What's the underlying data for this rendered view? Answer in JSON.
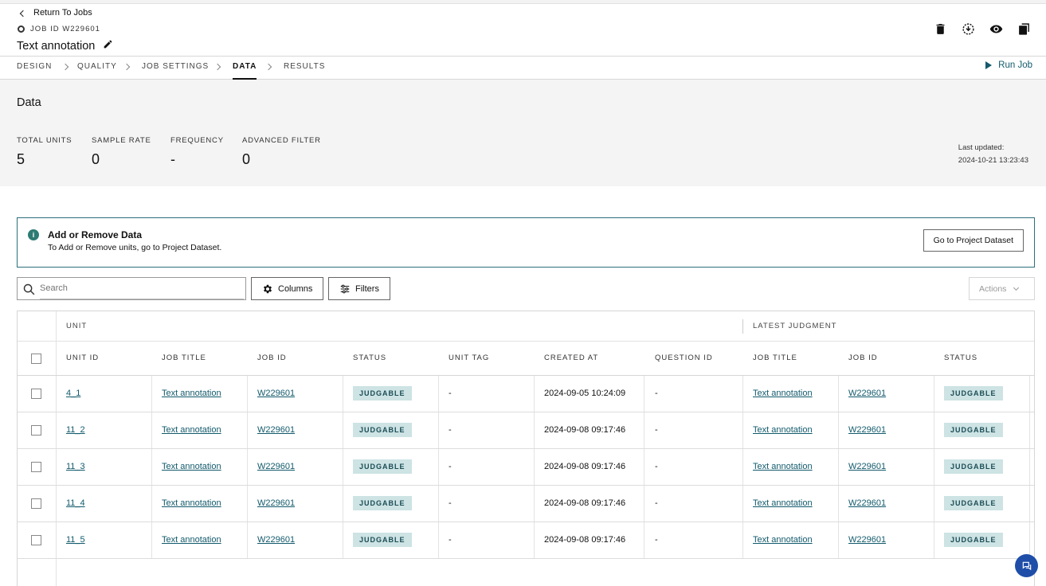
{
  "header": {
    "back_label": "Return To Jobs",
    "job_id_label": "JOB ID W229601",
    "title": "Text annotation",
    "icons": [
      "trash-icon",
      "download-icon",
      "eye-icon",
      "copy-icon"
    ]
  },
  "tabs": [
    {
      "label": "DESIGN",
      "active": false
    },
    {
      "label": "QUALITY",
      "active": false
    },
    {
      "label": "JOB SETTINGS",
      "active": false
    },
    {
      "label": "DATA",
      "active": true
    },
    {
      "label": "RESULTS",
      "active": false
    }
  ],
  "run_job_label": "Run Job",
  "data_panel": {
    "title": "Data",
    "stats": [
      {
        "label": "TOTAL UNITS",
        "value": "5"
      },
      {
        "label": "SAMPLE RATE",
        "value": "0"
      },
      {
        "label": "FREQUENCY",
        "value": "-"
      },
      {
        "label": "ADVANCED FILTER",
        "value": "0"
      }
    ],
    "last_updated_label": "Last updated:",
    "last_updated_value": "2024-10-21 13:23:43"
  },
  "notice": {
    "title": "Add or Remove Data",
    "description": "To Add or Remove units, go to Project Dataset.",
    "button_label": "Go to Project Dataset"
  },
  "toolbar": {
    "search_placeholder": "Search",
    "columns_label": "Columns",
    "filters_label": "Filters",
    "actions_label": "Actions"
  },
  "table": {
    "group_unit": "UNIT",
    "group_latest": "LATEST JUDGMENT",
    "columns": [
      "UNIT ID",
      "JOB TITLE",
      "JOB ID",
      "STATUS",
      "UNIT TAG",
      "CREATED AT",
      "QUESTION ID",
      "JOB TITLE",
      "JOB ID",
      "STATUS"
    ],
    "rows": [
      [
        "4_1",
        "Text annotation",
        "W229601",
        "JUDGABLE",
        "-",
        "2024-09-05 10:24:09",
        "-",
        "Text annotation",
        "W229601",
        "JUDGABLE"
      ],
      [
        "11_2",
        "Text annotation",
        "W229601",
        "JUDGABLE",
        "-",
        "2024-09-08 09:17:46",
        "-",
        "Text annotation",
        "W229601",
        "JUDGABLE"
      ],
      [
        "11_3",
        "Text annotation",
        "W229601",
        "JUDGABLE",
        "-",
        "2024-09-08 09:17:46",
        "-",
        "Text annotation",
        "W229601",
        "JUDGABLE"
      ],
      [
        "11_4",
        "Text annotation",
        "W229601",
        "JUDGABLE",
        "-",
        "2024-09-08 09:17:46",
        "-",
        "Text annotation",
        "W229601",
        "JUDGABLE"
      ],
      [
        "11_5",
        "Text annotation",
        "W229601",
        "JUDGABLE",
        "-",
        "2024-09-08 09:17:46",
        "-",
        "Text annotation",
        "W229601",
        "JUDGABLE"
      ]
    ]
  },
  "colors": {
    "accent": "#125a6c",
    "badge_bg": "#cde3e4",
    "chat_button": "#1f4ea8"
  }
}
